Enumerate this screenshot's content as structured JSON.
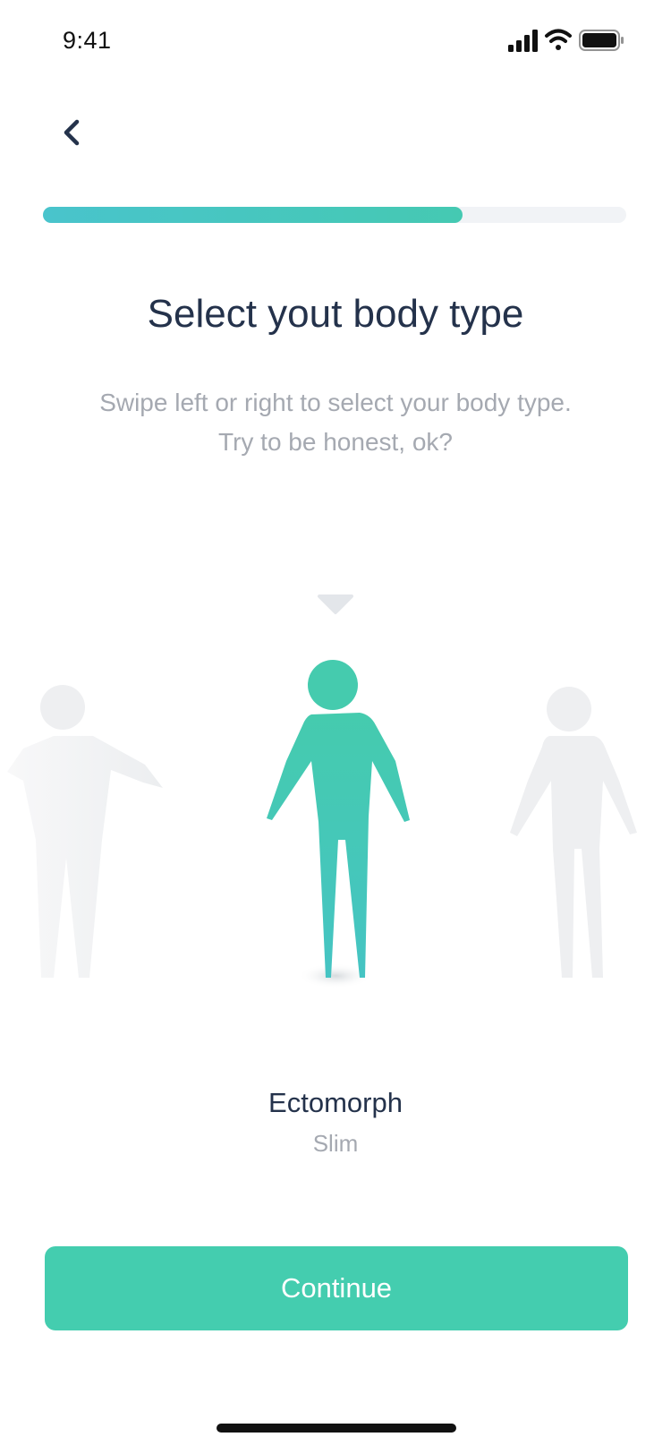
{
  "status_bar": {
    "time": "9:41"
  },
  "progress": {
    "value": 0.72
  },
  "header": {
    "title": "Select yout body type",
    "subtitle_line1": "Swipe left or right to select your body type.",
    "subtitle_line2": "Try to be honest, ok?"
  },
  "carousel": {
    "selected_index": 1,
    "selected": {
      "name": "Ectomorph",
      "description": "Slim"
    }
  },
  "actions": {
    "continue_label": "Continue"
  },
  "colors": {
    "accent": "#44cdaf",
    "progress_start": "#49c4cc",
    "text_primary": "#24324b",
    "text_secondary": "#a5a9b1",
    "inactive_figure": "#eeeff1"
  },
  "icons": [
    "back-chevron-icon",
    "cellular-signal-icon",
    "wifi-icon",
    "battery-icon",
    "arrow-down-indicator-icon",
    "arrow-up-indicator-icon"
  ]
}
